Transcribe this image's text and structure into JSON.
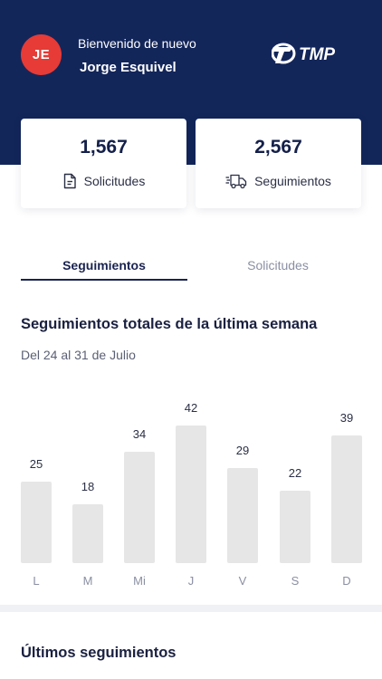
{
  "header": {
    "avatar_initials": "JE",
    "welcome_text": "Bienvenido de nuevo",
    "user_name": "Jorge Esquivel",
    "logo_text": "TMP",
    "background_color": "#13265a",
    "avatar_color": "#e63b36"
  },
  "stats": [
    {
      "value": "1,567",
      "label": "Solicitudes",
      "icon": "document-icon"
    },
    {
      "value": "2,567",
      "label": "Seguimientos",
      "icon": "delivery-truck-icon"
    }
  ],
  "tabs": [
    {
      "label": "Seguimientos",
      "active": true
    },
    {
      "label": "Solicitudes",
      "active": false
    }
  ],
  "section": {
    "title": "Seguimientos totales de la última semana",
    "subtitle": "Del 24 al 31 de Julio"
  },
  "chart_data": {
    "type": "bar",
    "categories": [
      "L",
      "M",
      "Mi",
      "J",
      "V",
      "S",
      "D"
    ],
    "values": [
      25,
      18,
      34,
      42,
      29,
      22,
      39
    ],
    "ylim": [
      0,
      42
    ],
    "grid": false,
    "bar_color": "#e6e6e6"
  },
  "bottom": {
    "title": "Últimos seguimientos"
  }
}
